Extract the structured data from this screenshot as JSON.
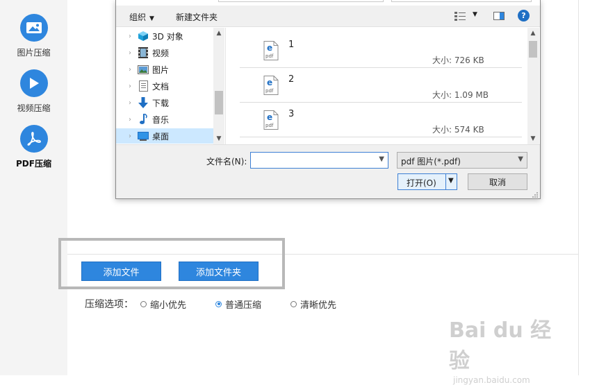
{
  "sidebar": {
    "items": [
      {
        "label": "图片压缩",
        "icon": "image-icon"
      },
      {
        "label": "视频压缩",
        "icon": "play-icon"
      },
      {
        "label": "PDF压缩",
        "icon": "pdf-icon"
      }
    ]
  },
  "main": {
    "add_file_label": "添加文件",
    "add_folder_label": "添加文件夹",
    "compress_title": "压缩选项：",
    "options": [
      {
        "label": "缩小优先",
        "selected": false
      },
      {
        "label": "普通压缩",
        "selected": true
      },
      {
        "label": "清晰优先",
        "selected": false
      }
    ]
  },
  "dialog": {
    "toolbar": {
      "organize_label": "组织",
      "new_folder_label": "新建文件夹",
      "help_label": "?"
    },
    "nav_items": [
      {
        "label": "3D 对象",
        "icon": "cube-3d-icon"
      },
      {
        "label": "视频",
        "icon": "video-icon"
      },
      {
        "label": "图片",
        "icon": "picture-icon"
      },
      {
        "label": "文档",
        "icon": "document-icon"
      },
      {
        "label": "下载",
        "icon": "download-icon"
      },
      {
        "label": "音乐",
        "icon": "music-icon"
      },
      {
        "label": "桌面",
        "icon": "desktop-icon",
        "selected": true
      }
    ],
    "files": [
      {
        "name": "1",
        "size": "大小: 726 KB",
        "icon": "pdf-file-icon"
      },
      {
        "name": "2",
        "size": "大小: 1.09 MB",
        "icon": "pdf-file-icon"
      },
      {
        "name": "3",
        "size": "大小: 574 KB",
        "icon": "pdf-file-icon"
      }
    ],
    "filename_label": "文件名(N):",
    "filename_value": "",
    "filetype_value": "pdf 图片(*.pdf)",
    "open_label": "打开(O)",
    "cancel_label": "取消"
  },
  "watermark": {
    "logo": "Bai du 经验",
    "url": "jingyan.baidu.com"
  },
  "colors": {
    "accent": "#2e86de",
    "selection": "#cce8ff"
  }
}
